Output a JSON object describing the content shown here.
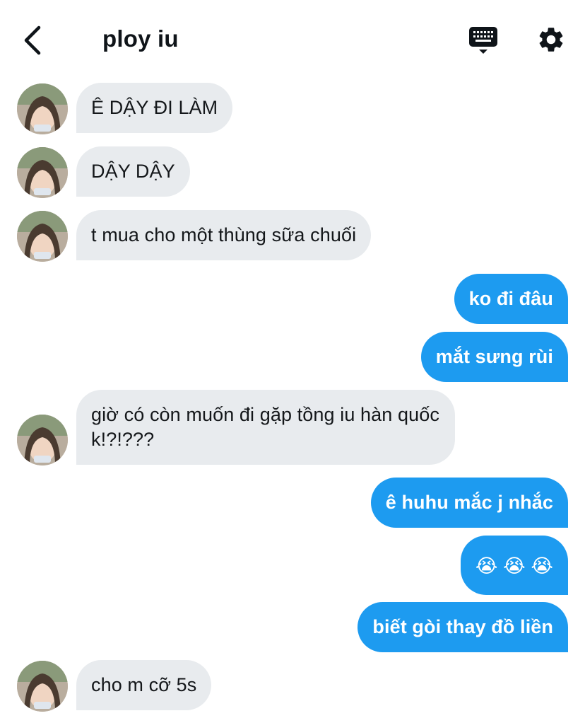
{
  "header": {
    "title": "ploy iu",
    "back_icon": "chevron-left-icon",
    "keyboard_icon": "keyboard-icon",
    "settings_icon": "gear-icon"
  },
  "colors": {
    "incoming_bubble": "#e8ebee",
    "outgoing_bubble": "#1d9bf0",
    "text_dark": "#14171a"
  },
  "messages": [
    {
      "dir": "in",
      "text": "Ê DẬY ĐI LÀM"
    },
    {
      "dir": "in",
      "text": "DẬY DẬY"
    },
    {
      "dir": "in",
      "text": "t mua cho một thùng sữa chuối"
    },
    {
      "dir": "out",
      "text": "ko đi đâu"
    },
    {
      "dir": "out",
      "text": "mắt sưng rùi"
    },
    {
      "dir": "in",
      "text": "giờ có còn muốn đi gặp tồng iu hàn quốc k!?!???"
    },
    {
      "dir": "out",
      "text": "ê huhu mắc j nhắc"
    },
    {
      "dir": "out",
      "text": "😭 😭 😭"
    },
    {
      "dir": "out",
      "text": "biết gòi thay đồ liền"
    },
    {
      "dir": "in",
      "text": "cho m cỡ 5s"
    }
  ]
}
